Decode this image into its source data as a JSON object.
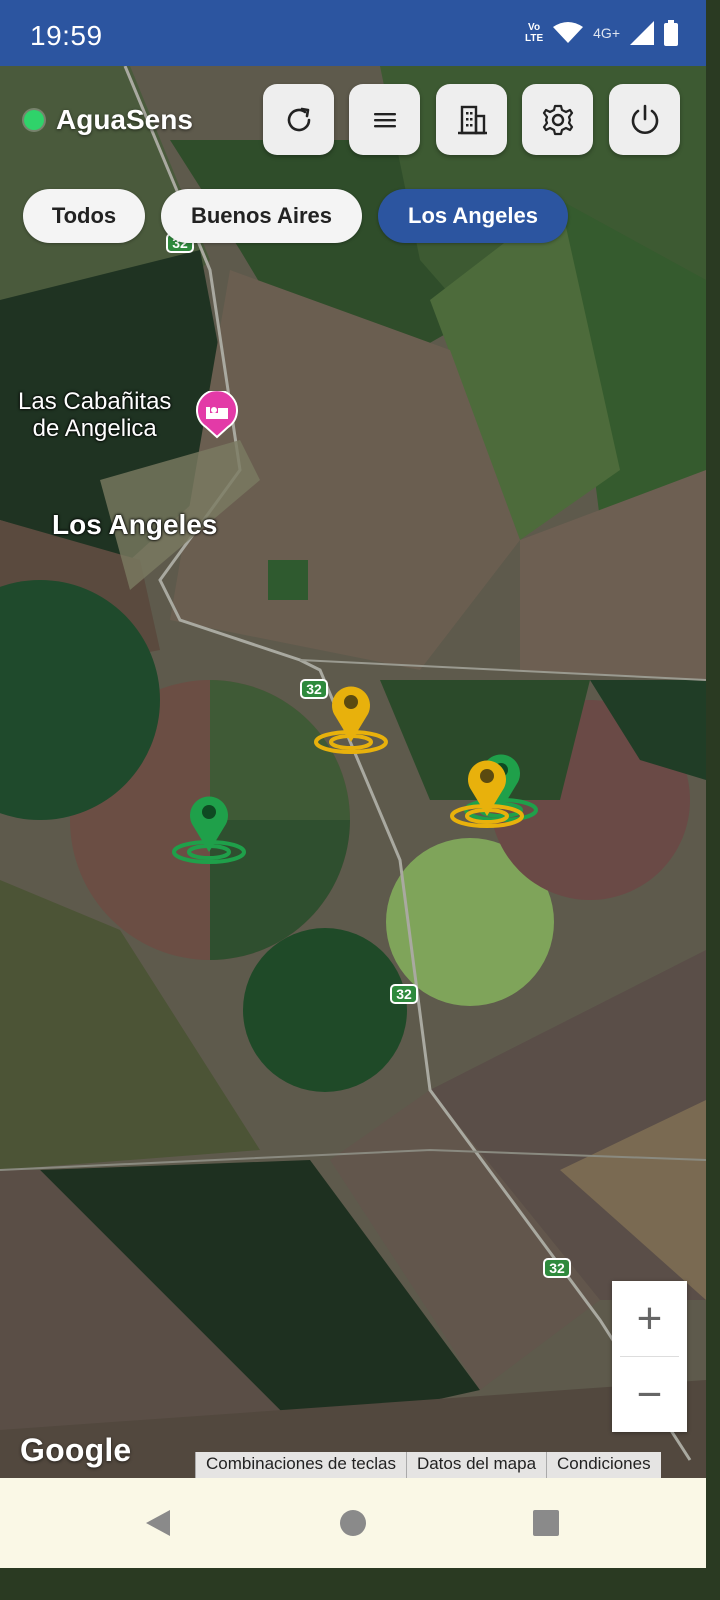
{
  "status_bar": {
    "time": "19:59",
    "volte_top": "Vo",
    "volte_bottom": "LTE",
    "network": "4G+"
  },
  "app": {
    "title": "AguaSens",
    "status_color": "#2fd36a"
  },
  "toolbar": {
    "refresh_icon": "refresh-icon",
    "menu_icon": "menu-icon",
    "building_icon": "building-icon",
    "settings_icon": "gear-icon",
    "power_icon": "power-icon"
  },
  "filters": {
    "items": [
      {
        "label": "Todos"
      },
      {
        "label": "Buenos Aires"
      },
      {
        "label": "Los Angeles",
        "active": true
      }
    ],
    "active_color": "#2c55a0"
  },
  "map": {
    "places": {
      "lodging": "Las Cabañitas\nde Angelica",
      "town": "Los Angeles"
    },
    "route_label": "32",
    "markers": [
      {
        "color": "#e8b10c",
        "status": "warning"
      },
      {
        "color": "#1fa04a",
        "status": "ok"
      },
      {
        "color": "#1fa04a",
        "status": "ok"
      },
      {
        "color": "#e8b10c",
        "status": "warning"
      }
    ],
    "zoom": {
      "in": "+",
      "out": "−"
    },
    "logo": "Google",
    "attribution": [
      "Combinaciones de teclas",
      "Datos del mapa",
      "Condiciones"
    ]
  },
  "nav": {
    "back": "back-icon",
    "home": "home-icon",
    "recents": "recents-icon"
  }
}
